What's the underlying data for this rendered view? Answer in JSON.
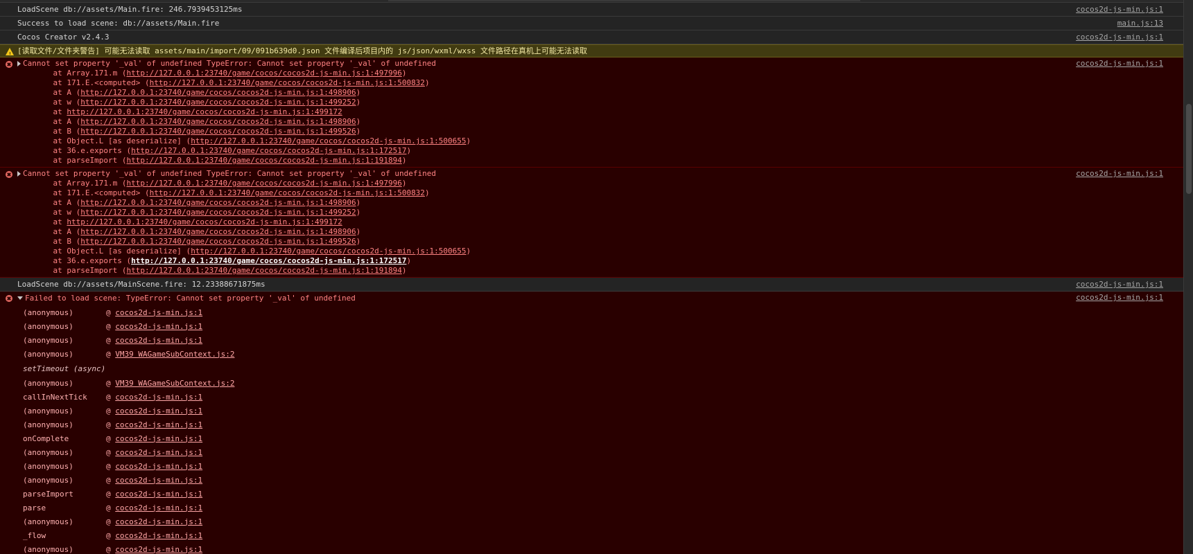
{
  "logs": {
    "load_main": {
      "text": "LoadScene db://assets/Main.fire: 246.7939453125ms",
      "src": "cocos2d-js-min.js:1"
    },
    "success": {
      "text": "Success to load scene: db://assets/Main.fire",
      "src": "main.js:13"
    },
    "creator": {
      "text": "Cocos Creator v2.4.3",
      "src": "cocos2d-js-min.js:1"
    },
    "load_mainscene": {
      "text": "LoadScene db://assets/MainScene.fire: 12.23388671875ms",
      "src": "cocos2d-js-min.js:1"
    }
  },
  "warning": {
    "text": "[读取文件/文件夹警告] 可能无法读取 assets/main/import/09/091b639d0.json 文件编译后项目内的 js/json/wxml/wxss 文件路径在真机上可能无法读取"
  },
  "error1": {
    "text": "Cannot set property '_val' of undefined TypeError: Cannot set property '_val' of undefined",
    "src": "cocos2d-js-min.js:1",
    "stack": [
      {
        "pre": "at Array.171.m (",
        "url": "http://127.0.0.1:23740/game/cocos/cocos2d-js-min.js:1:497996",
        "post": ")"
      },
      {
        "pre": "at 171.E.<computed> (",
        "url": "http://127.0.0.1:23740/game/cocos/cocos2d-js-min.js:1:500832",
        "post": ")"
      },
      {
        "pre": "at A (",
        "url": "http://127.0.0.1:23740/game/cocos/cocos2d-js-min.js:1:498906",
        "post": ")"
      },
      {
        "pre": "at w (",
        "url": "http://127.0.0.1:23740/game/cocos/cocos2d-js-min.js:1:499252",
        "post": ")"
      },
      {
        "pre": "at ",
        "url": "http://127.0.0.1:23740/game/cocos/cocos2d-js-min.js:1:499172",
        "post": ""
      },
      {
        "pre": "at A (",
        "url": "http://127.0.0.1:23740/game/cocos/cocos2d-js-min.js:1:498906",
        "post": ")"
      },
      {
        "pre": "at B (",
        "url": "http://127.0.0.1:23740/game/cocos/cocos2d-js-min.js:1:499526",
        "post": ")"
      },
      {
        "pre": "at Object.L [as deserialize] (",
        "url": "http://127.0.0.1:23740/game/cocos/cocos2d-js-min.js:1:500655",
        "post": ")"
      },
      {
        "pre": "at 36.e.exports (",
        "url": "http://127.0.0.1:23740/game/cocos/cocos2d-js-min.js:1:172517",
        "post": ")"
      },
      {
        "pre": "at parseImport (",
        "url": "http://127.0.0.1:23740/game/cocos/cocos2d-js-min.js:1:191894",
        "post": ")"
      }
    ]
  },
  "error2": {
    "text": "Cannot set property '_val' of undefined TypeError: Cannot set property '_val' of undefined",
    "src": "cocos2d-js-min.js:1",
    "stack": [
      {
        "pre": "at Array.171.m (",
        "url": "http://127.0.0.1:23740/game/cocos/cocos2d-js-min.js:1:497996",
        "post": ")"
      },
      {
        "pre": "at 171.E.<computed> (",
        "url": "http://127.0.0.1:23740/game/cocos/cocos2d-js-min.js:1:500832",
        "post": ")"
      },
      {
        "pre": "at A (",
        "url": "http://127.0.0.1:23740/game/cocos/cocos2d-js-min.js:1:498906",
        "post": ")"
      },
      {
        "pre": "at w (",
        "url": "http://127.0.0.1:23740/game/cocos/cocos2d-js-min.js:1:499252",
        "post": ")"
      },
      {
        "pre": "at ",
        "url": "http://127.0.0.1:23740/game/cocos/cocos2d-js-min.js:1:499172",
        "post": ""
      },
      {
        "pre": "at A (",
        "url": "http://127.0.0.1:23740/game/cocos/cocos2d-js-min.js:1:498906",
        "post": ")"
      },
      {
        "pre": "at B (",
        "url": "http://127.0.0.1:23740/game/cocos/cocos2d-js-min.js:1:499526",
        "post": ")"
      },
      {
        "pre": "at Object.L [as deserialize] (",
        "url": "http://127.0.0.1:23740/game/cocos/cocos2d-js-min.js:1:500655",
        "post": ")"
      },
      {
        "pre": "at 36.e.exports (",
        "url": "http://127.0.0.1:23740/game/cocos/cocos2d-js-min.js:1:172517",
        "post": ")",
        "hot": true
      },
      {
        "pre": "at parseImport (",
        "url": "http://127.0.0.1:23740/game/cocos/cocos2d-js-min.js:1:191894",
        "post": ")"
      }
    ]
  },
  "error3": {
    "text": "Failed to load scene: TypeError: Cannot set property '_val' of undefined",
    "src": "cocos2d-js-min.js:1",
    "frames": [
      {
        "fn": "(anonymous)",
        "at": "@ ",
        "file": "cocos2d-js-min.js:1"
      },
      {
        "fn": "(anonymous)",
        "at": "@ ",
        "file": "cocos2d-js-min.js:1"
      },
      {
        "fn": "(anonymous)",
        "at": "@ ",
        "file": "cocos2d-js-min.js:1"
      },
      {
        "fn": "(anonymous)",
        "at": "@ ",
        "file": "VM39 WAGameSubContext.js:2"
      },
      {
        "fn": "setTimeout (async)",
        "async": true
      },
      {
        "fn": "(anonymous)",
        "at": "@ ",
        "file": "VM39 WAGameSubContext.js:2"
      },
      {
        "fn": "callInNextTick",
        "at": "@ ",
        "file": "cocos2d-js-min.js:1"
      },
      {
        "fn": "(anonymous)",
        "at": "@ ",
        "file": "cocos2d-js-min.js:1"
      },
      {
        "fn": "(anonymous)",
        "at": "@ ",
        "file": "cocos2d-js-min.js:1"
      },
      {
        "fn": "onComplete",
        "at": "@ ",
        "file": "cocos2d-js-min.js:1"
      },
      {
        "fn": "(anonymous)",
        "at": "@ ",
        "file": "cocos2d-js-min.js:1"
      },
      {
        "fn": "(anonymous)",
        "at": "@ ",
        "file": "cocos2d-js-min.js:1"
      },
      {
        "fn": "(anonymous)",
        "at": "@ ",
        "file": "cocos2d-js-min.js:1"
      },
      {
        "fn": "parseImport",
        "at": "@ ",
        "file": "cocos2d-js-min.js:1"
      },
      {
        "fn": "parse",
        "at": "@ ",
        "file": "cocos2d-js-min.js:1"
      },
      {
        "fn": "(anonymous)",
        "at": "@ ",
        "file": "cocos2d-js-min.js:1"
      },
      {
        "fn": "_flow",
        "at": "@ ",
        "file": "cocos2d-js-min.js:1"
      },
      {
        "fn": "(anonymous)",
        "at": "@ ",
        "file": "cocos2d-js-min.js:1"
      }
    ]
  }
}
